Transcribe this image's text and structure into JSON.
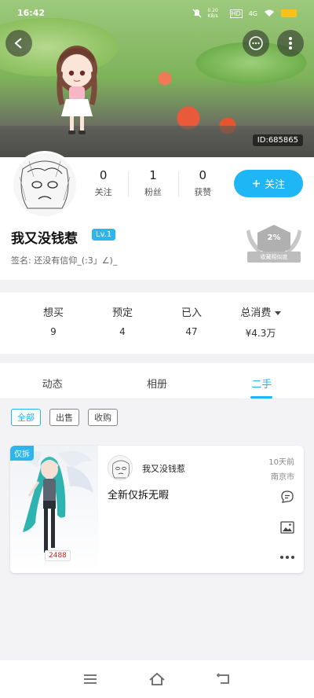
{
  "status_bar": {
    "time": "16:42",
    "network_speed": "0.20 KB/s",
    "signal_label": "4G"
  },
  "header": {
    "uid": "ID:685865"
  },
  "profile": {
    "stats": [
      {
        "value": "0",
        "label": "关注"
      },
      {
        "value": "1",
        "label": "粉丝"
      },
      {
        "value": "0",
        "label": "获赞"
      }
    ],
    "follow_label": "关注",
    "username": "我又没钱惹",
    "level": "Lv.1",
    "signature": "签名: 还没有信仰_(:3」∠)_",
    "similarity_pct": "2%",
    "similarity_label": "收藏相似度"
  },
  "purchase_stats": [
    {
      "label": "想买",
      "value": "9"
    },
    {
      "label": "预定",
      "value": "4"
    },
    {
      "label": "已入",
      "value": "47"
    },
    {
      "label": "总消费",
      "value": "¥4.3万"
    }
  ],
  "tabs": [
    {
      "label": "动态",
      "active": false
    },
    {
      "label": "相册",
      "active": false
    },
    {
      "label": "二手",
      "active": true
    }
  ],
  "filters": [
    {
      "label": "全部",
      "active": true
    },
    {
      "label": "出售",
      "active": false
    },
    {
      "label": "收购",
      "active": false
    }
  ],
  "listing": {
    "tag": "仅拆",
    "price": "2488",
    "user": "我又没钱惹",
    "time": "10天前",
    "city": "南京市",
    "title": "全新仅拆无暇"
  },
  "colors": {
    "accent": "#1fb6f5",
    "tag": "#2bb6ee"
  }
}
